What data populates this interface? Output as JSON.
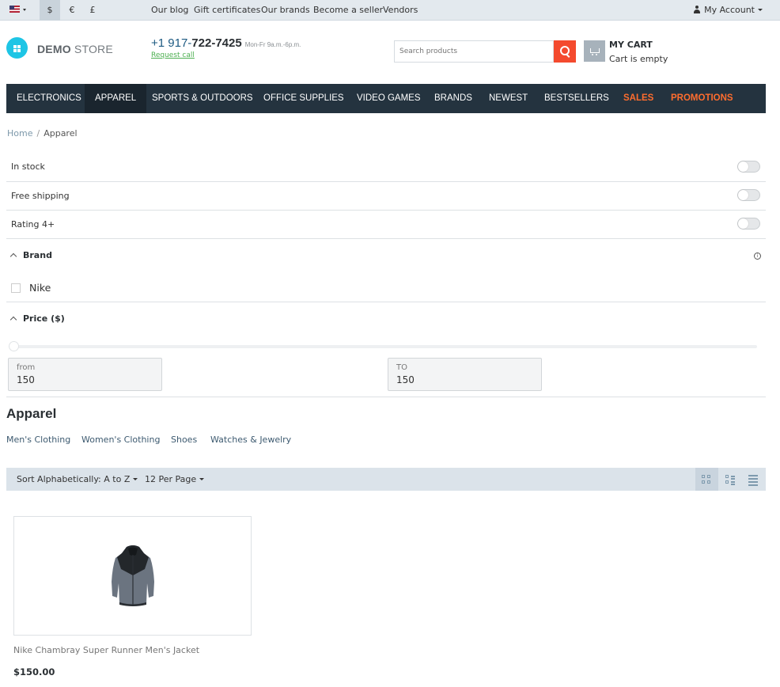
{
  "topbar": {
    "flag_icon": "us-flag-icon",
    "currencies": [
      "$",
      "€",
      "£"
    ],
    "active_currency": "$",
    "links": [
      "Our blog",
      "Gift certificates",
      "Our brands",
      "Become a seller",
      "Vendors"
    ],
    "account_label": "My Account"
  },
  "header": {
    "logo_bold": "DEMO",
    "logo_light": " STORE",
    "phone_prefix": "+1 917-",
    "phone_main": "722-7425",
    "phone_hours": "Mon-Fr 9a.m.-6p.m.",
    "request_call": "Request call",
    "search_placeholder": "Search products",
    "cart_title": "MY CART",
    "cart_status": "Cart is empty",
    "accent_color": "#f44a2e",
    "logo_color": "#1ec5e5"
  },
  "nav": {
    "items": [
      "ELECTRONICS",
      "APPAREL",
      "SPORTS & OUTDOORS",
      "OFFICE SUPPLIES",
      "VIDEO GAMES",
      "BRANDS",
      "NEWEST",
      "BESTSELLERS",
      "SALES",
      "PROMOTIONS"
    ],
    "active": "APPAREL",
    "highlight_color": "#ff6d2e"
  },
  "breadcrumb": {
    "home": "Home",
    "separator": "/",
    "current": "Apparel"
  },
  "filters": {
    "toggles": [
      {
        "label": "In stock",
        "on": false
      },
      {
        "label": "Free shipping",
        "on": false
      },
      {
        "label": "Rating 4+",
        "on": false
      }
    ],
    "brand": {
      "title": "Brand",
      "options": [
        {
          "label": "Nike",
          "checked": false
        }
      ]
    },
    "price": {
      "title": "Price ($)",
      "from_label": "from",
      "from_value": "150",
      "to_label": "TO",
      "to_value": "150"
    }
  },
  "category": {
    "title": "Apparel",
    "subcategories": [
      "Men's Clothing",
      "Women's Clothing",
      "Shoes",
      "Watches & Jewelry"
    ]
  },
  "sortbar": {
    "sort_label": "Sort Alphabetically: A to Z",
    "per_page_label": "12 Per Page",
    "views": [
      "grid-view-icon",
      "list-view-icon",
      "compact-list-icon"
    ],
    "active_view": "grid-view-icon"
  },
  "products": [
    {
      "name": "Nike Chambray Super Runner Men's Jacket",
      "price": "$150.00",
      "image_icon": "jacket-image"
    }
  ]
}
